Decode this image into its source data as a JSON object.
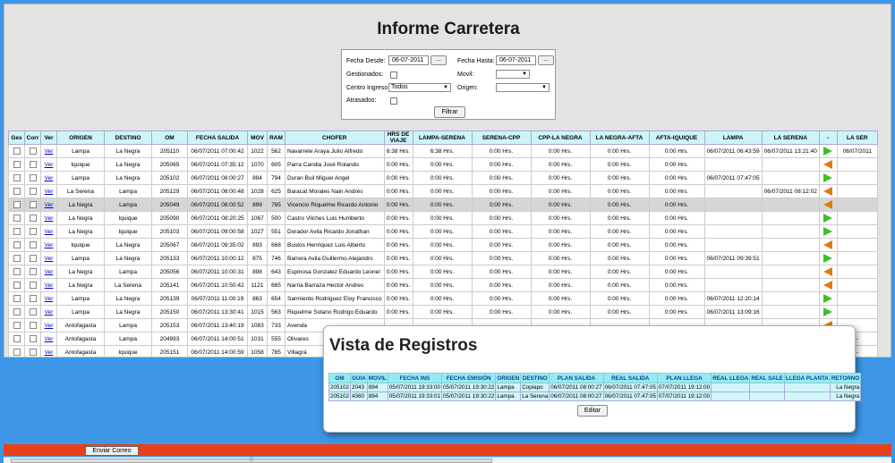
{
  "title": "Informe Carretera",
  "filters": {
    "fecha_desde_label": "Fecha Desde:",
    "fecha_desde_value": "06-07-2011",
    "fecha_hasta_label": "Fecha Hasta:",
    "fecha_hasta_value": "06-07-2011",
    "dots": "...",
    "gestionados_label": "Gestionados:",
    "movil_label": "Movil:",
    "centro_label": "Centro Ingreso",
    "centro_value": "Todos",
    "origen_label": "Origen:",
    "atrasados_label": "Atrasados:",
    "filtrar_label": "Filtrar"
  },
  "columns": [
    "Ges",
    "Corr",
    "Ver",
    "ORIGEN",
    "DESTINO",
    "OM",
    "FECHA SALIDA",
    "MOV",
    "RAM",
    "CHOFER",
    "HRS DE VIAJE",
    "LAMPA-SERENA",
    "SERENA-CPP",
    "CPP-LA NEGRA",
    "LA NEGRA-AFTA",
    "AFTA-IQUIQUE",
    "LAMPA",
    "LA SERENA",
    "-",
    "LA SER"
  ],
  "rows": [
    {
      "ver": "Ver",
      "origen": "Lampa",
      "destino": "La Negra",
      "om": "205110",
      "fecha": "06/07/2011 07:00:42",
      "mov": "1022",
      "ram": "562",
      "chofer": "Navarrete Araya Julio Alfredo",
      "hrs": "6:38 Hrs.",
      "ls": "6:38 Hrs.",
      "sc": "0:00 Hrs.",
      "cl": "0:00 Hrs.",
      "la": "0:00 Hrs.",
      "ai": "0:00 Hrs.",
      "lampa": "06/07/2011 06:43:59",
      "serena": "06/07/2011 13:21:40",
      "arrow": "right",
      "extra": "06/07/2011"
    },
    {
      "ver": "Ver",
      "origen": "Iquique",
      "destino": "La Negra",
      "om": "205065",
      "fecha": "06/07/2011 07:35:12",
      "mov": "1070",
      "ram": "605",
      "chofer": "Parra Candia José Rolando",
      "hrs": "0:00 Hrs.",
      "ls": "0:00 Hrs.",
      "sc": "0:00 Hrs.",
      "cl": "0:00 Hrs.",
      "la": "0:00 Hrs.",
      "ai": "0:00 Hrs.",
      "lampa": "",
      "serena": "",
      "arrow": "left",
      "extra": ""
    },
    {
      "ver": "Ver",
      "origen": "Lampa",
      "destino": "La Negra",
      "om": "205102",
      "fecha": "06/07/2011 08:00:27",
      "mov": "894",
      "ram": "794",
      "chofer": "Duran Buil Miguel Angel",
      "hrs": "0:00 Hrs.",
      "ls": "0:00 Hrs.",
      "sc": "0:00 Hrs.",
      "cl": "0:00 Hrs.",
      "la": "0:00 Hrs.",
      "ai": "0:00 Hrs.",
      "lampa": "06/07/2011 07:47:05",
      "serena": "",
      "arrow": "right",
      "extra": ""
    },
    {
      "ver": "Ver",
      "origen": "La Serena",
      "destino": "Lampa",
      "om": "205129",
      "fecha": "06/07/2011 08:00:48",
      "mov": "1028",
      "ram": "625",
      "chofer": "Baracat Morales Nain Andrés",
      "hrs": "0:00 Hrs.",
      "ls": "0:00 Hrs.",
      "sc": "0:00 Hrs.",
      "cl": "0:00 Hrs.",
      "la": "0:00 Hrs.",
      "ai": "0:00 Hrs.",
      "lampa": "",
      "serena": "06/07/2011 08:12:02",
      "arrow": "left",
      "extra": ""
    },
    {
      "ver": "Ver",
      "origen": "La Negra",
      "destino": "Lampa",
      "om": "205049",
      "fecha": "06/07/2011 08:00:52",
      "mov": "899",
      "ram": "785",
      "chofer": "Vicencio Riquelme Ricardo Antonio",
      "hrs": "0:00 Hrs.",
      "ls": "0:00 Hrs.",
      "sc": "0:00 Hrs.",
      "cl": "0:00 Hrs.",
      "la": "0:00 Hrs.",
      "ai": "0:00 Hrs.",
      "lampa": "",
      "serena": "",
      "arrow": "left",
      "extra": ""
    },
    {
      "ver": "Ver",
      "origen": "La Negra",
      "destino": "Iquique",
      "om": "205090",
      "fecha": "06/07/2011 08:20:25",
      "mov": "1067",
      "ram": "500",
      "chofer": "Castro Vilches Luis Humberto",
      "hrs": "0:00 Hrs.",
      "ls": "0:00 Hrs.",
      "sc": "0:00 Hrs.",
      "cl": "0:00 Hrs.",
      "la": "0:00 Hrs.",
      "ai": "0:00 Hrs.",
      "lampa": "",
      "serena": "",
      "arrow": "right",
      "extra": ""
    },
    {
      "ver": "Ver",
      "origen": "La Negra",
      "destino": "Iquique",
      "om": "205103",
      "fecha": "06/07/2011 09:00:58",
      "mov": "1027",
      "ram": "551",
      "chofer": "Dorador Avila Ricardo Jonathan",
      "hrs": "0:00 Hrs.",
      "ls": "0:00 Hrs.",
      "sc": "0:00 Hrs.",
      "cl": "0:00 Hrs.",
      "la": "0:00 Hrs.",
      "ai": "0:00 Hrs.",
      "lampa": "",
      "serena": "",
      "arrow": "right",
      "extra": ""
    },
    {
      "ver": "Ver",
      "origen": "Iquique",
      "destino": "La Negra",
      "om": "205067",
      "fecha": "06/07/2011 09:35:02",
      "mov": "893",
      "ram": "668",
      "chofer": "Bustos Henriquez Luis Alberto",
      "hrs": "0:00 Hrs.",
      "ls": "0:00 Hrs.",
      "sc": "0:00 Hrs.",
      "cl": "0:00 Hrs.",
      "la": "0:00 Hrs.",
      "ai": "0:00 Hrs.",
      "lampa": "",
      "serena": "",
      "arrow": "left",
      "extra": ""
    },
    {
      "ver": "Ver",
      "origen": "Lampa",
      "destino": "La Negra",
      "om": "205133",
      "fecha": "06/07/2011 10:00:12",
      "mov": "875",
      "ram": "746",
      "chofer": "Barrera Avila Guillermo Alejandro",
      "hrs": "0:00 Hrs.",
      "ls": "0:00 Hrs.",
      "sc": "0:00 Hrs.",
      "cl": "0:00 Hrs.",
      "la": "0:00 Hrs.",
      "ai": "0:00 Hrs.",
      "lampa": "06/07/2011 09:39:51",
      "serena": "",
      "arrow": "right",
      "extra": ""
    },
    {
      "ver": "Ver",
      "origen": "La Negra",
      "destino": "Lampa",
      "om": "205056",
      "fecha": "06/07/2011 10:00:31",
      "mov": "898",
      "ram": "643",
      "chofer": "Espinosa Gonzalez Eduardo Leonel",
      "hrs": "0:00 Hrs.",
      "ls": "0:00 Hrs.",
      "sc": "0:00 Hrs.",
      "cl": "0:00 Hrs.",
      "la": "0:00 Hrs.",
      "ai": "0:00 Hrs.",
      "lampa": "",
      "serena": "",
      "arrow": "left",
      "extra": ""
    },
    {
      "ver": "Ver",
      "origen": "La Negra",
      "destino": "La Serena",
      "om": "205141",
      "fecha": "06/07/2011 10:50:42",
      "mov": "1121",
      "ram": "665",
      "chofer": "Narria Barraza Hector Andres",
      "hrs": "0:00 Hrs.",
      "ls": "0:00 Hrs.",
      "sc": "0:00 Hrs.",
      "cl": "0:00 Hrs.",
      "la": "0:00 Hrs.",
      "ai": "0:00 Hrs.",
      "lampa": "",
      "serena": "",
      "arrow": "left",
      "extra": ""
    },
    {
      "ver": "Ver",
      "origen": "Lampa",
      "destino": "La Negra",
      "om": "205139",
      "fecha": "06/07/2011 11:00:19",
      "mov": "863",
      "ram": "654",
      "chofer": "Sarmiento Rodriguez Eloy Francisco",
      "hrs": "0:00 Hrs.",
      "ls": "0:00 Hrs.",
      "sc": "0:00 Hrs.",
      "cl": "0:00 Hrs.",
      "la": "0:00 Hrs.",
      "ai": "0:00 Hrs.",
      "lampa": "06/07/2011 12:20:14",
      "serena": "",
      "arrow": "right",
      "extra": ""
    },
    {
      "ver": "Ver",
      "origen": "Lampa",
      "destino": "La Negra",
      "om": "205150",
      "fecha": "06/07/2011 13:30:41",
      "mov": "1015",
      "ram": "563",
      "chofer": "Riquelme Solano Rodrigo Eduardo",
      "hrs": "0:00 Hrs.",
      "ls": "0:00 Hrs.",
      "sc": "0:00 Hrs.",
      "cl": "0:00 Hrs.",
      "la": "0:00 Hrs.",
      "ai": "0:00 Hrs.",
      "lampa": "06/07/2011 13:09:16",
      "serena": "",
      "arrow": "right",
      "extra": ""
    },
    {
      "ver": "Ver",
      "origen": "Antofagasta",
      "destino": "Lampa",
      "om": "205153",
      "fecha": "06/07/2011 13:40:19",
      "mov": "1083",
      "ram": "733",
      "chofer": "Avenda",
      "hrs": "",
      "ls": "",
      "sc": "",
      "cl": "",
      "la": "",
      "ai": "",
      "lampa": "",
      "serena": "",
      "arrow": "left",
      "extra": ""
    },
    {
      "ver": "Ver",
      "origen": "Antofagasta",
      "destino": "Lampa",
      "om": "204993",
      "fecha": "06/07/2011 14:00:51",
      "mov": "1031",
      "ram": "555",
      "chofer": "Olivares",
      "hrs": "",
      "ls": "",
      "sc": "",
      "cl": "",
      "la": "",
      "ai": "",
      "lampa": "",
      "serena": "",
      "arrow": "left",
      "extra": "-"
    },
    {
      "ver": "Ver",
      "origen": "Antofagasta",
      "destino": "Iquique",
      "om": "205151",
      "fecha": "06/07/2011 14:00:59",
      "mov": "1058",
      "ram": "785",
      "chofer": "Villagrá",
      "hrs": "",
      "ls": "",
      "sc": "",
      "cl": "",
      "la": "",
      "ai": "",
      "lampa": "",
      "serena": "",
      "arrow": "left",
      "extra": "-"
    },
    {
      "ver": "Ver",
      "origen": "Lampa",
      "destino": "La Negra",
      "om": "205156",
      "fecha": "06/07/2011 15:00:02",
      "mov": "887",
      "ram": "516",
      "chofer": "Andrad",
      "hrs": "",
      "ls": "",
      "sc": "",
      "cl": "",
      "la": "",
      "ai": "",
      "lampa": "",
      "serena": "",
      "arrow": "right",
      "extra": "-"
    }
  ],
  "vista": {
    "title": "Vista de Registros",
    "columns": [
      "OM",
      "GUIA",
      "MOVIL",
      "FECHA INS",
      "FECHA EMISIÓN",
      "ORIGEN",
      "DESTINO",
      "PLAN SALIDA",
      "REAL SALIDA",
      "PLAN LLEGA",
      "REAL LLEGA",
      "REAL SALE",
      "LLEGA PLANTA",
      "RETORNO"
    ],
    "rows": [
      [
        "205102",
        "2043",
        "894",
        "05/07/2011 19:33:00",
        "05/07/2011 19:30:22",
        "Lampa",
        "Copiapo",
        "06/07/2011 08:00:27",
        "06/07/2011 07:47:05",
        "07/07/2011 19:12:00",
        "",
        "",
        "",
        "La Negra"
      ],
      [
        "205102",
        "4360",
        "894",
        "05/07/2011 19:33:01",
        "05/07/2011 19:30:22",
        "Lampa",
        "La Serena",
        "06/07/2011 08:00:27",
        "06/07/2011 07:47:05",
        "07/07/2011 19:12:00",
        "",
        "",
        "",
        "La Negra"
      ]
    ],
    "editar_label": "Editar"
  },
  "footer": {
    "enviar_label": "Enviar Correo",
    "scroll_grip": "|||"
  },
  "colors": {
    "background": "#3d97e6",
    "header": "#cdf5f9",
    "bottom_bar": "#e8411a",
    "arrow_right": "#3bc12b",
    "arrow_left": "#e07a10"
  }
}
